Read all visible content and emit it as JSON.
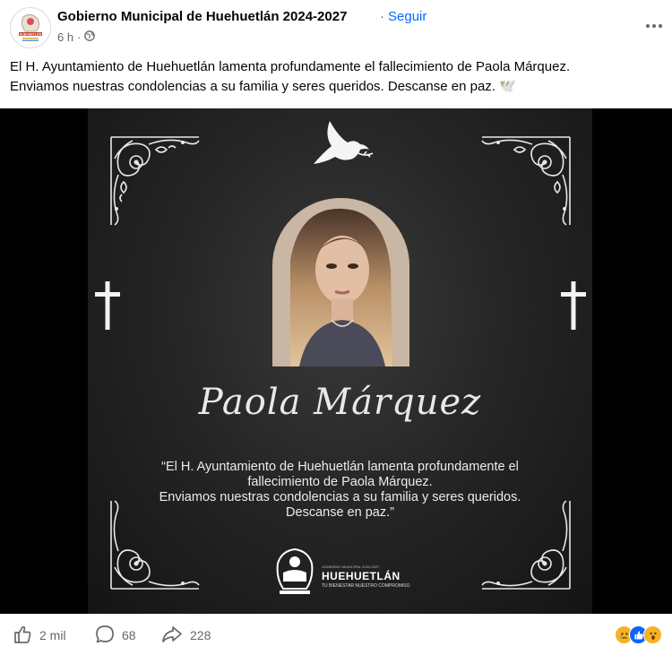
{
  "post": {
    "page_name": "Gobierno Municipal de Huehuetlán 2024-2027",
    "separator": "·",
    "follow_label": "Seguir",
    "time": "6 h",
    "time_sep": "·",
    "avatar_text": "HUEHUETLÁN",
    "text_line1": "El H. Ayuntamiento de Huehuetlán lamenta profundamente el fallecimiento de Paola Márquez.",
    "text_line2": "Enviamos nuestras condolencias a su familia y seres queridos. Descanse en paz. 🕊️"
  },
  "card": {
    "name": "Paola Márquez",
    "quote_line1": "“El H. Ayuntamiento de Huehuetlán lamenta profundamente el",
    "quote_line2": "fallecimiento de Paola Márquez.",
    "quote_line3": "Enviamos nuestras condolencias a su familia y seres queridos.",
    "quote_line4": "Descanse en paz.”",
    "logo_name": "HUEHUETLÁN",
    "logo_top": "GOBIERNO MUNICIPAL 2024-2027",
    "logo_tagline": "TU BIENESTAR NUESTRO COMPROMISO"
  },
  "actions": {
    "likes": "2 mil",
    "comments": "68",
    "shares": "228"
  },
  "icons": {
    "like": "thumbs-up-icon",
    "comment": "comment-bubble-icon",
    "share": "share-arrow-icon",
    "globe": "globe-icon",
    "more": "more-dots-icon",
    "dove": "dove-icon",
    "cross": "cross-icon",
    "reactions": [
      "sad-reaction-icon",
      "like-reaction-icon",
      "wow-reaction-icon"
    ]
  },
  "colors": {
    "accent": "#0866ff",
    "muted": "#65676b",
    "card_bg": "#262626"
  }
}
